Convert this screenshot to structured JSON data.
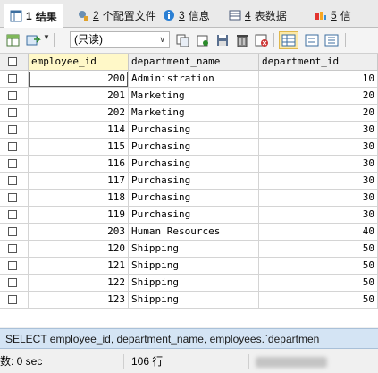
{
  "tabs": [
    {
      "num": "1",
      "label": "结果",
      "icon": "result-grid-icon",
      "active": true
    },
    {
      "num": "2",
      "label": "个配置文件",
      "icon": "profile-icon",
      "active": false
    },
    {
      "num": "3",
      "label": "信息",
      "icon": "info-icon",
      "active": false
    },
    {
      "num": "4",
      "label": "表数据",
      "icon": "table-data-icon",
      "active": false
    },
    {
      "num": "5",
      "label": "信",
      "icon": "info-alt-icon",
      "active": false
    }
  ],
  "toolbar": {
    "readonly_label": "(只读)",
    "icons": [
      "grid-view-icon",
      "export-icon",
      "save-icon",
      "copy-icon",
      "floppy-icon",
      "delete-icon",
      "refresh-icon",
      "grid-mode-icon",
      "form-mode-icon",
      "text-mode-icon"
    ]
  },
  "grid": {
    "columns": [
      "employee_id",
      "department_name",
      "department_id"
    ],
    "rows": [
      [
        "200",
        "Administration",
        "10"
      ],
      [
        "201",
        "Marketing",
        "20"
      ],
      [
        "202",
        "Marketing",
        "20"
      ],
      [
        "114",
        "Purchasing",
        "30"
      ],
      [
        "115",
        "Purchasing",
        "30"
      ],
      [
        "116",
        "Purchasing",
        "30"
      ],
      [
        "117",
        "Purchasing",
        "30"
      ],
      [
        "118",
        "Purchasing",
        "30"
      ],
      [
        "119",
        "Purchasing",
        "30"
      ],
      [
        "203",
        "Human Resources",
        "40"
      ],
      [
        "120",
        "Shipping",
        "50"
      ],
      [
        "121",
        "Shipping",
        "50"
      ],
      [
        "122",
        "Shipping",
        "50"
      ],
      [
        "123",
        "Shipping",
        "50"
      ]
    ]
  },
  "sql_text": "SELECT employee_id, department_name, employees.`departmen",
  "status": {
    "exec_time": "数: 0 sec",
    "row_count": "106 行"
  },
  "colors": {
    "header_highlight": "#fff8c8",
    "sql_bar_bg": "#d4e4f4"
  }
}
